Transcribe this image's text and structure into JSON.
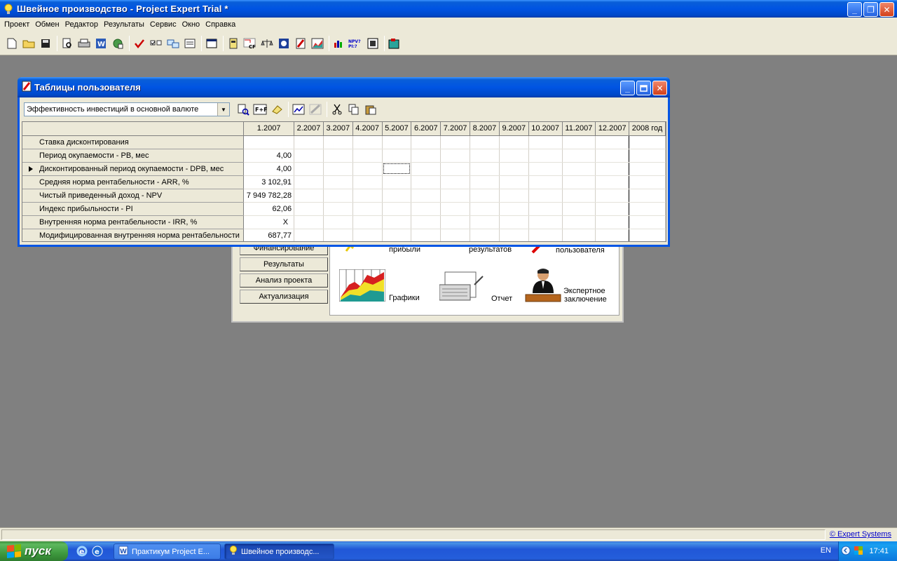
{
  "app": {
    "title": "Швейное производство - Project Expert Trial *",
    "window_buttons": {
      "minimize": "_",
      "restore": "❐",
      "close": "✕"
    }
  },
  "menu": [
    "Проект",
    "Обмен",
    "Редактор",
    "Результаты",
    "Сервис",
    "Окно",
    "Справка"
  ],
  "background_window": {
    "side_buttons": [
      "Финансирование",
      "Результаты",
      "Анализ проекта",
      "Актуализация"
    ],
    "labels": {
      "profit": "прибыли",
      "results": "результатов",
      "user": "пользователя",
      "charts": "Графики",
      "report": "Отчет",
      "expert_line1": "Экспертное",
      "expert_line2": "заключение"
    }
  },
  "child_window": {
    "title": "Таблицы пользователя",
    "combo_value": "Эффективность инвестиций в основной валюте",
    "combo_arrow": "▼",
    "columns": [
      "1.2007",
      "2.2007",
      "3.2007",
      "4.2007",
      "5.2007",
      "6.2007",
      "7.2007",
      "8.2007",
      "9.2007",
      "10.2007",
      "11.2007",
      "12.2007",
      "2008 год"
    ],
    "rows": [
      {
        "label": "Ставка дисконтирования",
        "value": ""
      },
      {
        "label": "Период окупаемости - PB, мес",
        "value": "4,00"
      },
      {
        "label": "Дисконтированный период окупаемости - DPB, мес",
        "value": "4,00"
      },
      {
        "label": "Средняя норма рентабельности - ARR, %",
        "value": "3 102,91"
      },
      {
        "label": "Чистый приведенный доход - NPV",
        "value": "7 949 782,28"
      },
      {
        "label": "Индекс прибыльности - PI",
        "value": "62,06"
      },
      {
        "label": "Внутренняя норма рентабельности - IRR, %",
        "value": "X"
      },
      {
        "label": "Модифицированная внутренняя норма рентабельности",
        "value": "687,77"
      }
    ]
  },
  "statusbar": {
    "link": "© Expert Systems"
  },
  "taskbar": {
    "start": "пуск",
    "tasks": [
      "Практикум Project E...",
      "Швейное производс..."
    ],
    "lang": "EN",
    "clock": "17:41"
  }
}
